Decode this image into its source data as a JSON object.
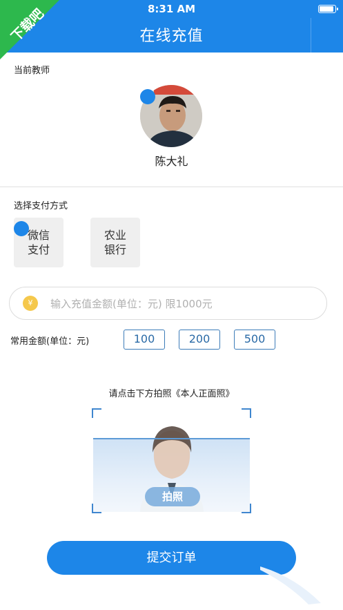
{
  "status_bar": {
    "time": "8:31 AM"
  },
  "corner_badge": {
    "text": "下载吧"
  },
  "nav": {
    "title": "在线充值"
  },
  "teacher": {
    "section_label": "当前教师",
    "name": "陈大礼"
  },
  "payment": {
    "section_label": "选择支付方式",
    "options": [
      {
        "line1": "微信",
        "line2": "支付"
      },
      {
        "line1": "农业",
        "line2": "银行"
      }
    ]
  },
  "amount": {
    "placeholder": "输入充值金额(单位：元) 限1000元",
    "icon_symbol": "¥"
  },
  "quick_amounts": {
    "label": "常用金额(单位：元)",
    "values": [
      "100",
      "200",
      "500"
    ]
  },
  "photo": {
    "hint": "请点击下方拍照《本人正面照》",
    "button_label": "拍照"
  },
  "submit": {
    "label": "提交订单"
  },
  "colors": {
    "primary": "#1d86e8",
    "badge": "#2db84d",
    "quick_border": "#3b7bb8",
    "yen": "#f5c84c"
  },
  "icons": {
    "battery": "battery-icon",
    "yen": "yen-icon",
    "avatar": "teacher-avatar",
    "silhouette": "person-silhouette-icon"
  }
}
